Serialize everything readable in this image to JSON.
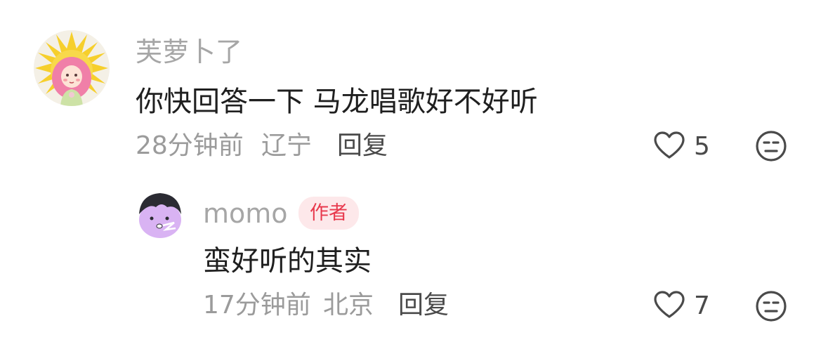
{
  "comments": [
    {
      "username": "芙萝卜了",
      "content": "你快回答一下 马龙唱歌好不好听",
      "time": "28分钟前",
      "location": "辽宁",
      "reply_label": "回复",
      "likes": "5"
    }
  ],
  "reply": {
    "username": "momo",
    "badge": "作者",
    "content": "蛮好听的其实",
    "time": "17分钟前",
    "location": "北京",
    "reply_label": "回复",
    "likes": "7"
  },
  "icons": {
    "like": "heart-outline-icon",
    "dislike": "unamused-face-icon"
  },
  "colors": {
    "badge_text": "#e8394d",
    "badge_bg": "#fde8ea",
    "meta_text": "#9b9b9b"
  }
}
